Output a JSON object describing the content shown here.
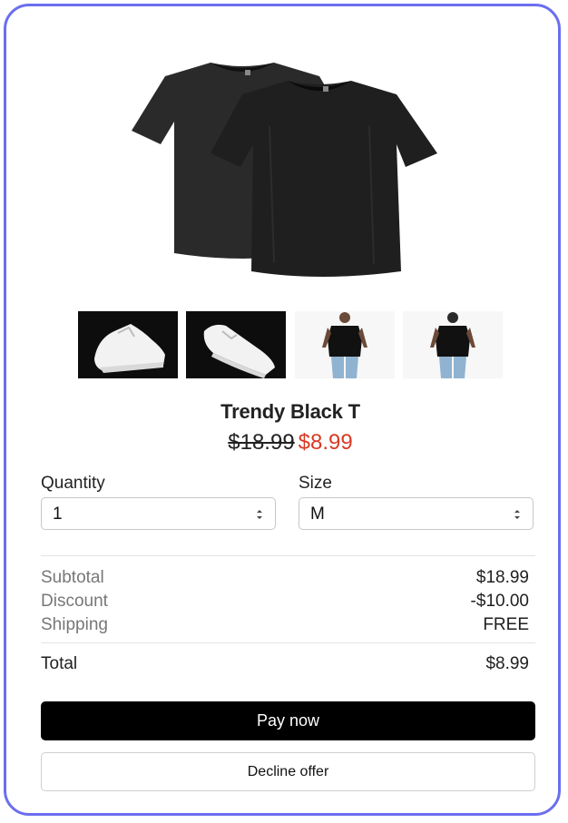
{
  "product": {
    "title": "Trendy Black T",
    "original_price": "$18.99",
    "sale_price": "$8.99",
    "images": [
      "tshirt-pair-image",
      "sneaker-side-image",
      "sneaker-angle-image",
      "model-front-image",
      "model-back-image"
    ]
  },
  "form": {
    "quantity_label": "Quantity",
    "quantity_value": "1",
    "size_label": "Size",
    "size_value": "M"
  },
  "summary": {
    "subtotal_label": "Subtotal",
    "subtotal_value": "$18.99",
    "discount_label": "Discount",
    "discount_value": "-$10.00",
    "shipping_label": "Shipping",
    "shipping_value": "FREE",
    "total_label": "Total",
    "total_value": "$8.99"
  },
  "actions": {
    "pay_label": "Pay now",
    "decline_label": "Decline offer"
  },
  "colors": {
    "accent_border": "#6b6ef0",
    "sale_price": "#d93a23",
    "primary_button": "#000000"
  }
}
